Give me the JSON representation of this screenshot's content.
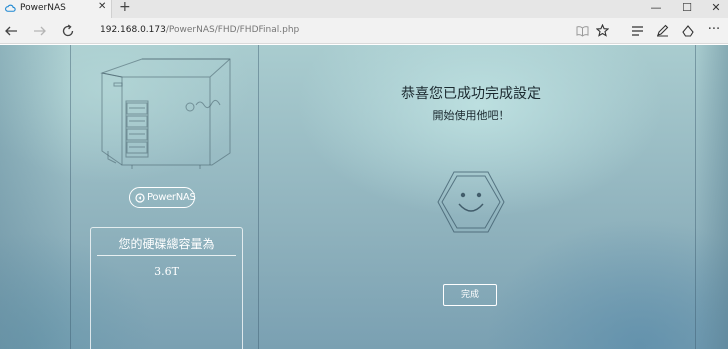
{
  "browser": {
    "tab": {
      "title": "PowerNAS",
      "favicon": "cloud-icon"
    },
    "new_tab_symbol": "+",
    "close_symbol": "✕",
    "window_controls": {
      "minimize": "—",
      "maximize": "☐",
      "close": "✕"
    },
    "address": {
      "host": "192.168.0.173",
      "path": "/PowerNAS/FHD/FHDFinal.php"
    },
    "nav_icons": [
      "back-icon",
      "forward-icon",
      "refresh-icon"
    ],
    "toolbar_icons": [
      "reading-view-icon",
      "favorite-star-icon",
      "hub-icon",
      "web-note-icon",
      "share-icon",
      "more-icon"
    ]
  },
  "sidebar": {
    "brand": "PowerNAS",
    "capacity_label": "您的硬碟總容量為",
    "capacity_value": "3.6T"
  },
  "main": {
    "title": "恭喜您已成功完成設定",
    "subtitle": "開始使用他吧！",
    "done_button": "完成"
  },
  "colors": {
    "background_top": "#a9cccf",
    "background_bottom": "#7aa0b2",
    "title_text": "#1c2a30",
    "accent_white": "#ffffff"
  }
}
